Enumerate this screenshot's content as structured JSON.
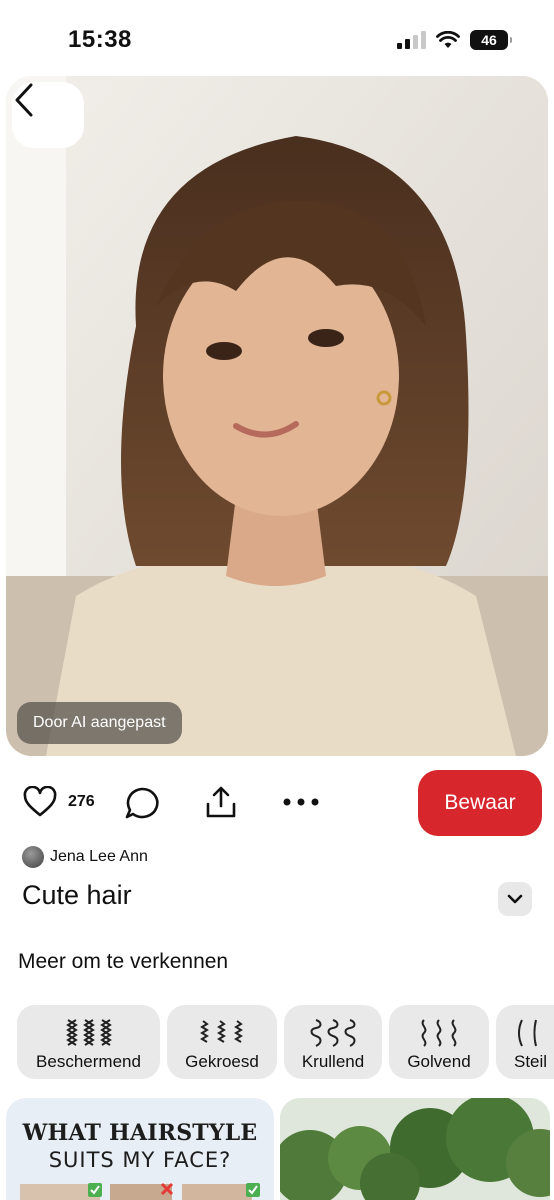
{
  "status_bar": {
    "time": "15:38",
    "battery": "46"
  },
  "image": {
    "ai_badge": "Door AI aangepast"
  },
  "actions": {
    "like_count": "276",
    "save_label": "Bewaar"
  },
  "pin": {
    "author": "Jena Lee Ann",
    "title": "Cute hair"
  },
  "explore": {
    "heading": "Meer om te verkennen",
    "chips": [
      {
        "label": "Beschermend",
        "icon": "braids-icon"
      },
      {
        "label": "Gekroesd",
        "icon": "kinky-hair-icon"
      },
      {
        "label": "Krullend",
        "icon": "curly-hair-icon"
      },
      {
        "label": "Golvend",
        "icon": "wavy-hair-icon"
      },
      {
        "label": "Steil",
        "icon": "straight-hair-icon"
      }
    ]
  },
  "related_pins": [
    {
      "title_line1": "WHAT HAIRSTYLE",
      "title_line2": "SUITS MY FACE?"
    }
  ],
  "colors": {
    "save_button": "#d7262c"
  }
}
